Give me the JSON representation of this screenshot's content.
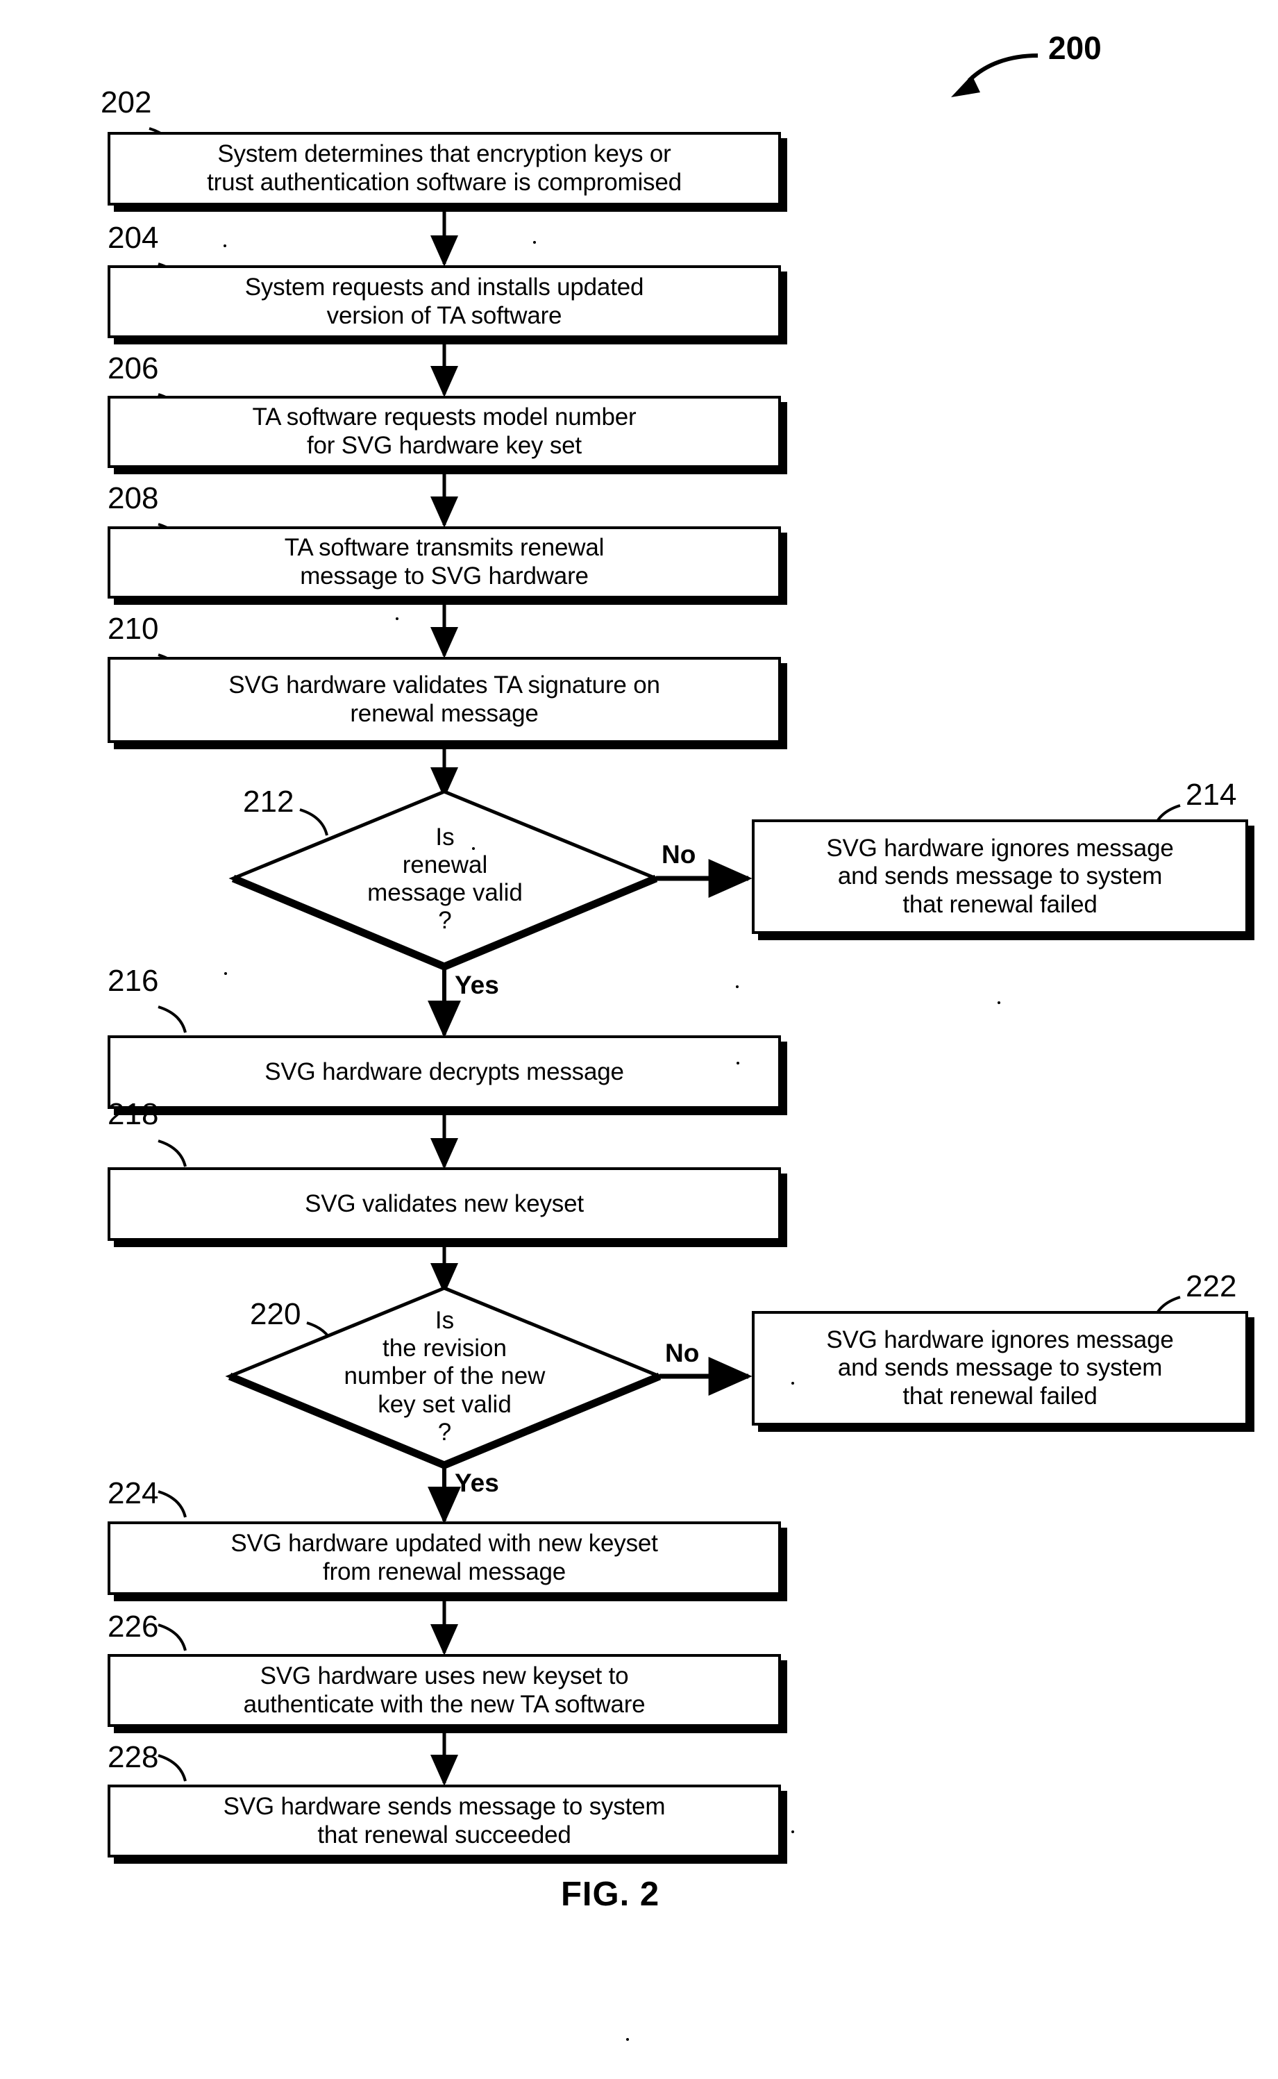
{
  "figure": {
    "number_label": "200",
    "caption": "FIG. 2",
    "title_visible": false
  },
  "flowchart": {
    "type": "flowchart",
    "orientation": "top-to-bottom",
    "nodes": [
      {
        "ref": "202",
        "shape": "process",
        "text": "System determines that encryption keys or\ntrust authentication software is compromised"
      },
      {
        "ref": "204",
        "shape": "process",
        "text": "System requests and installs updated\nversion of TA software"
      },
      {
        "ref": "206",
        "shape": "process",
        "text": "TA software requests model number\nfor SVG hardware key set"
      },
      {
        "ref": "208",
        "shape": "process",
        "text": "TA software transmits renewal\nmessage to SVG hardware"
      },
      {
        "ref": "210",
        "shape": "process",
        "text": "SVG hardware validates TA signature on\nrenewal message"
      },
      {
        "ref": "212",
        "shape": "decision",
        "text": "Is\nrenewal\nmessage valid\n?"
      },
      {
        "ref": "214",
        "shape": "process",
        "text": "SVG hardware ignores message\nand sends message to system\nthat renewal failed"
      },
      {
        "ref": "216",
        "shape": "process",
        "text": "SVG hardware decrypts message"
      },
      {
        "ref": "218",
        "shape": "process",
        "text": "SVG validates new keyset"
      },
      {
        "ref": "220",
        "shape": "decision",
        "text": "Is\nthe revision\nnumber of the new\nkey set valid\n?"
      },
      {
        "ref": "222",
        "shape": "process",
        "text": "SVG hardware ignores message\nand sends message to system\nthat renewal failed"
      },
      {
        "ref": "224",
        "shape": "process",
        "text": "SVG hardware updated with new keyset\nfrom renewal message"
      },
      {
        "ref": "226",
        "shape": "process",
        "text": "SVG hardware uses new keyset to\nauthenticate with the new TA software"
      },
      {
        "ref": "228",
        "shape": "process",
        "text": "SVG hardware sends message to system\nthat renewal succeeded"
      }
    ],
    "edge_labels": {
      "no_212": "No",
      "yes_212": "Yes",
      "no_220": "No",
      "yes_220": "Yes"
    }
  },
  "style": {
    "ink": "#000000",
    "paper": "#ffffff"
  }
}
